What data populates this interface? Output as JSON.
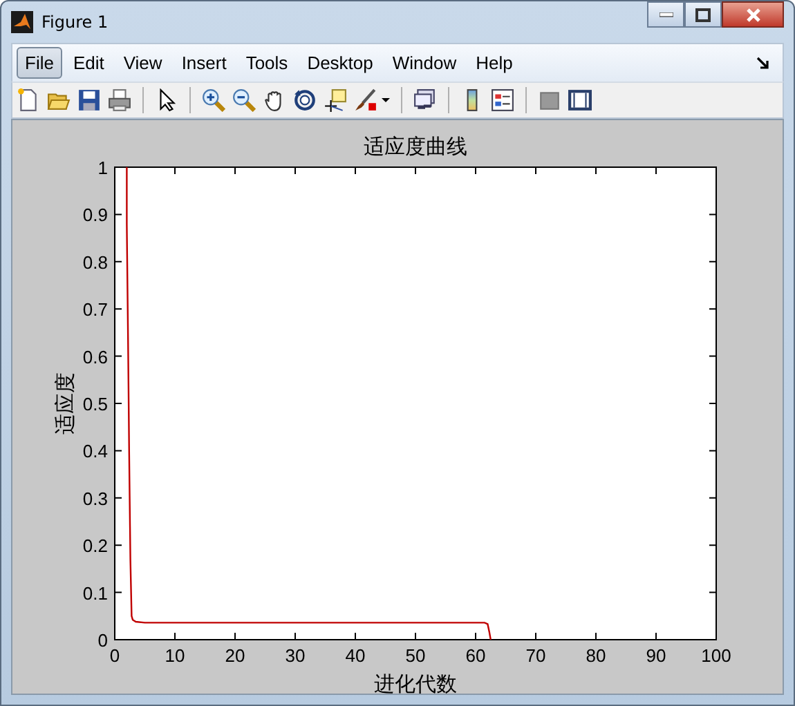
{
  "window": {
    "title": "Figure 1"
  },
  "menu": [
    {
      "label": "File",
      "selected": true
    },
    {
      "label": "Edit",
      "selected": false
    },
    {
      "label": "View",
      "selected": false
    },
    {
      "label": "Insert",
      "selected": false
    },
    {
      "label": "Tools",
      "selected": false
    },
    {
      "label": "Desktop",
      "selected": false
    },
    {
      "label": "Window",
      "selected": false
    },
    {
      "label": "Help",
      "selected": false
    }
  ],
  "axes": {
    "chart_data": {
      "type": "line",
      "title": "适应度曲线",
      "xlabel": "进化代数",
      "ylabel": "适应度",
      "x": [
        2,
        2,
        2.2,
        2.4,
        2.6,
        2.8,
        3,
        3.5,
        5,
        10,
        20,
        30,
        40,
        50,
        60,
        61.5,
        62,
        62.3,
        62.5
      ],
      "series": [
        {
          "color": "#c00000",
          "values": [
            1,
            0.88,
            0.64,
            0.4,
            0.17,
            0.05,
            0.042,
            0.038,
            0.036,
            0.036,
            0.036,
            0.036,
            0.036,
            0.036,
            0.036,
            0.036,
            0.033,
            0.015,
            0
          ]
        }
      ],
      "xlim": [
        0,
        100
      ],
      "ylim": [
        0,
        1
      ],
      "xticks": [
        0,
        10,
        20,
        30,
        40,
        50,
        60,
        70,
        80,
        90,
        100
      ],
      "yticks": [
        0,
        0.1,
        0.2,
        0.3,
        0.4,
        0.5,
        0.6,
        0.7,
        0.8,
        0.9,
        1
      ]
    }
  }
}
